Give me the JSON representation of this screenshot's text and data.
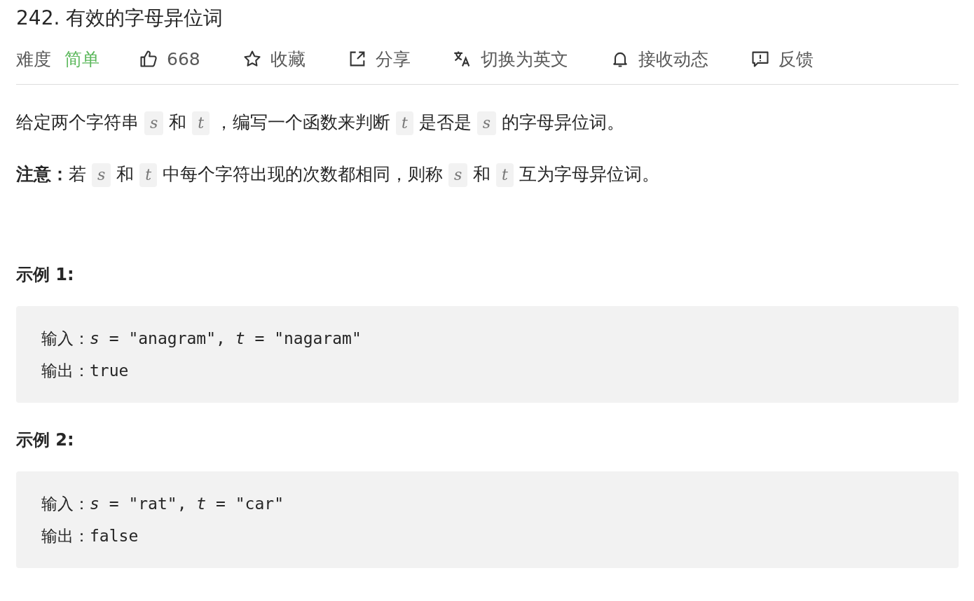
{
  "title": "242. 有效的字母异位词",
  "toolbar": {
    "difficulty_label": "难度",
    "difficulty": "简单",
    "actions": [
      {
        "kind": "like",
        "label": "668"
      },
      {
        "kind": "star",
        "label": "收藏"
      },
      {
        "kind": "share",
        "label": "分享"
      },
      {
        "kind": "translate",
        "label": "切换为英文"
      },
      {
        "kind": "bell",
        "label": "接收动态"
      },
      {
        "kind": "feedback",
        "label": "反馈"
      }
    ]
  },
  "description": [
    [
      {
        "kind": "text",
        "text": "给定两个字符串 "
      },
      {
        "kind": "var",
        "text": "s"
      },
      {
        "kind": "text",
        "text": " 和 "
      },
      {
        "kind": "var",
        "text": "t"
      },
      {
        "kind": "text",
        "text": " ，编写一个函数来判断 "
      },
      {
        "kind": "var",
        "text": "t"
      },
      {
        "kind": "text",
        "text": " 是否是 "
      },
      {
        "kind": "var",
        "text": "s"
      },
      {
        "kind": "text",
        "text": " 的字母异位词。"
      }
    ],
    [
      {
        "kind": "bold",
        "text": "注意："
      },
      {
        "kind": "text",
        "text": "若 "
      },
      {
        "kind": "var",
        "text": "s"
      },
      {
        "kind": "text",
        "text": " 和 "
      },
      {
        "kind": "var",
        "text": "t"
      },
      {
        "kind": "text",
        "text": " 中每个字符出现的次数都相同，则称 "
      },
      {
        "kind": "var",
        "text": "s"
      },
      {
        "kind": "text",
        "text": " 和 "
      },
      {
        "kind": "var",
        "text": "t"
      },
      {
        "kind": "text",
        "text": " 互为字母异位词。"
      }
    ]
  ],
  "examples": [
    {
      "heading": "示例 1:",
      "lines": [
        [
          {
            "kind": "text",
            "text": "输入："
          },
          {
            "kind": "italic",
            "text": "s"
          },
          {
            "kind": "text",
            "text": " = \"anagram\", "
          },
          {
            "kind": "italic",
            "text": "t"
          },
          {
            "kind": "text",
            "text": " = \"nagaram\""
          }
        ],
        [
          {
            "kind": "text",
            "text": "输出：true"
          }
        ]
      ]
    },
    {
      "heading": "示例 2:",
      "lines": [
        [
          {
            "kind": "text",
            "text": "输入："
          },
          {
            "kind": "italic",
            "text": "s"
          },
          {
            "kind": "text",
            "text": " = \"rat\", "
          },
          {
            "kind": "italic",
            "text": "t"
          },
          {
            "kind": "text",
            "text": " = \"car\""
          }
        ],
        [
          {
            "kind": "text",
            "text": "输出：false"
          }
        ]
      ]
    }
  ]
}
